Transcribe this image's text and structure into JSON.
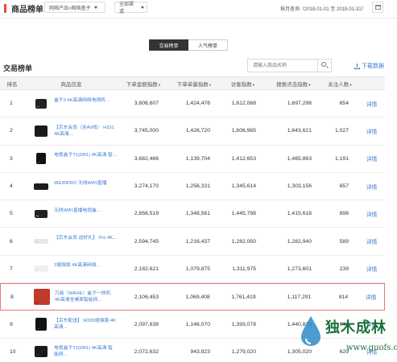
{
  "header": {
    "title": "商品榜单",
    "category_select": "网络产品>网络盒子",
    "channel_select": "全部渠道",
    "date_range": "按月查询（2018-01-01 至 2018-01-31）"
  },
  "tabs": [
    {
      "label": "交易榜单",
      "active": true
    },
    {
      "label": "人气榜单",
      "active": false
    }
  ],
  "section": {
    "title": "交易榜单",
    "search_placeholder": "请输入商品名称",
    "download_label": "下载数据"
  },
  "table": {
    "headers": [
      "排名",
      "商品信息",
      "下单金额指数",
      "下单单量指数",
      "访客指数",
      "搜索点击指数",
      "关注人数",
      ""
    ],
    "sortable": [
      false,
      false,
      true,
      true,
      true,
      true,
      true,
      false
    ],
    "detail_label": "详情",
    "rows": [
      {
        "rank": "1",
        "name": "盒子3 4K高清网络电视机...",
        "gmv": "3,806,607",
        "qty": "1,424,476",
        "visit": "1,612,068",
        "click": "1,697,298",
        "follow": "654"
      },
      {
        "rank": "2",
        "name": "【京东会员（含AV线） H321 4K高清...",
        "gmv": "3,745,000",
        "qty": "1,426,720",
        "visit": "1,606,965",
        "click": "1,643,621",
        "follow": "1,027"
      },
      {
        "rank": "3",
        "name": "电视盒子T1(DB1) 4K高清 智...",
        "gmv": "3,682,466",
        "qty": "1,139,704",
        "visit": "1,412,653",
        "click": "1,465,863",
        "follow": "1,191"
      },
      {
        "rank": "4",
        "name": "WE30PRO 无线WIFI直播",
        "gmv": "3,274,170",
        "qty": "1,256,331",
        "visit": "1,345,614",
        "click": "1,303,156",
        "follow": "657"
      },
      {
        "rank": "5",
        "name": "无线WIFI直播电视盒...",
        "gmv": "2,856,519",
        "qty": "1,348,561",
        "visit": "1,445,798",
        "click": "1,415,618",
        "follow": "898"
      },
      {
        "rank": "6",
        "name": "【京东会员 送好礼】 Pro 4K...",
        "gmv": "2,594,745",
        "qty": "1,216,437",
        "visit": "1,282,050",
        "click": "1,282,940",
        "follow": "589"
      },
      {
        "rank": "7",
        "name": "3增强版 4K高清网络...",
        "gmv": "2,182,621",
        "qty": "1,079,875",
        "visit": "1,311,975",
        "click": "1,273,601",
        "follow": "239"
      },
      {
        "rank": "8",
        "name": "万能（WAHE）盒子一体机 4K高清全桌面智能网...",
        "gmv": "2,106,453",
        "qty": "1,069,408",
        "visit": "1,761,419",
        "click": "1,117,291",
        "follow": "814"
      },
      {
        "rank": "9",
        "name": "【京东配送】 M330增强版 4K高清...",
        "gmv": "2,097,638",
        "qty": "1,146,070",
        "visit": "1,393,078",
        "click": "1,440,825",
        "follow": "644"
      },
      {
        "rank": "10",
        "name": "电视盒子T1(DB1) 4K高清 智能网...",
        "gmv": "2,072,632",
        "qty": "943,923",
        "visit": "1,279,020",
        "click": "1,305,020",
        "follow": "629"
      }
    ]
  },
  "watermark": {
    "title": "独木成林",
    "url": "www.guofs.com"
  },
  "colors": {
    "accent": "#e74c3c",
    "link": "#3a7bd5",
    "highlight_border": "#e87878",
    "watermark": "#1a6f3a"
  }
}
